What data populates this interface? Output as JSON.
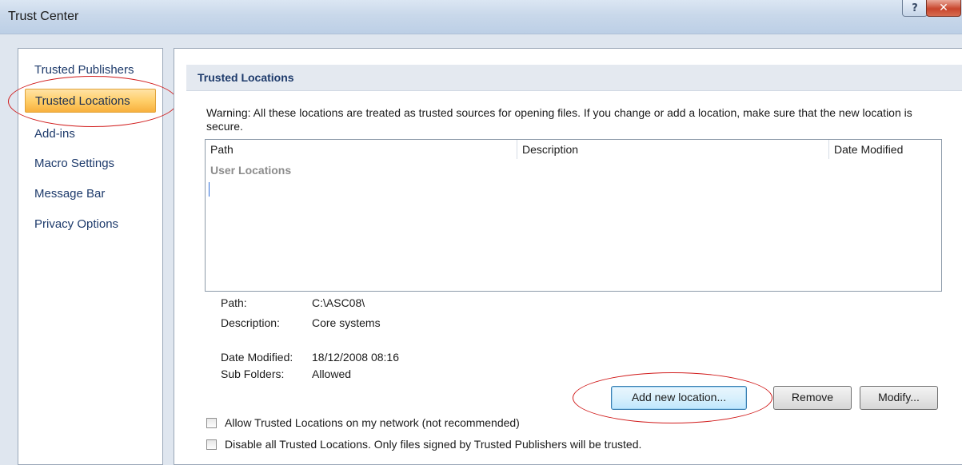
{
  "window": {
    "title": "Trust Center",
    "help_glyph": "?",
    "close_glyph": "✕"
  },
  "nav": {
    "items": [
      {
        "label": "Trusted Publishers"
      },
      {
        "label": "Trusted Locations",
        "selected": true
      },
      {
        "label": "Add-ins"
      },
      {
        "label": "Macro Settings"
      },
      {
        "label": "Message Bar"
      },
      {
        "label": "Privacy Options"
      }
    ]
  },
  "section": {
    "title": "Trusted Locations",
    "warning": "Warning: All these locations are treated as trusted sources for opening files.  If you change or add a location, make sure that the new location is secure."
  },
  "table": {
    "columns": [
      "Path",
      "Description",
      "Date Modified"
    ],
    "group_label": "User Locations"
  },
  "details": {
    "path_label": "Path:",
    "path_value": "C:\\ASC08\\",
    "description_label": "Description:",
    "description_value": "Core systems",
    "date_label": "Date Modified:",
    "date_value": "18/12/2008 08:16",
    "subfolders_label": "Sub Folders:",
    "subfolders_value": "Allowed"
  },
  "buttons": {
    "add": "Add new location...",
    "remove": "Remove",
    "modify": "Modify..."
  },
  "options": {
    "allow_network": "Allow Trusted Locations on my network (not recommended)",
    "disable_all": "Disable all Trusted Locations. Only files signed by Trusted Publishers will be trusted."
  },
  "colors": {
    "selection": "#ffcf6a",
    "annotation": "#d11c1c",
    "header_text": "#1d3a6b"
  }
}
